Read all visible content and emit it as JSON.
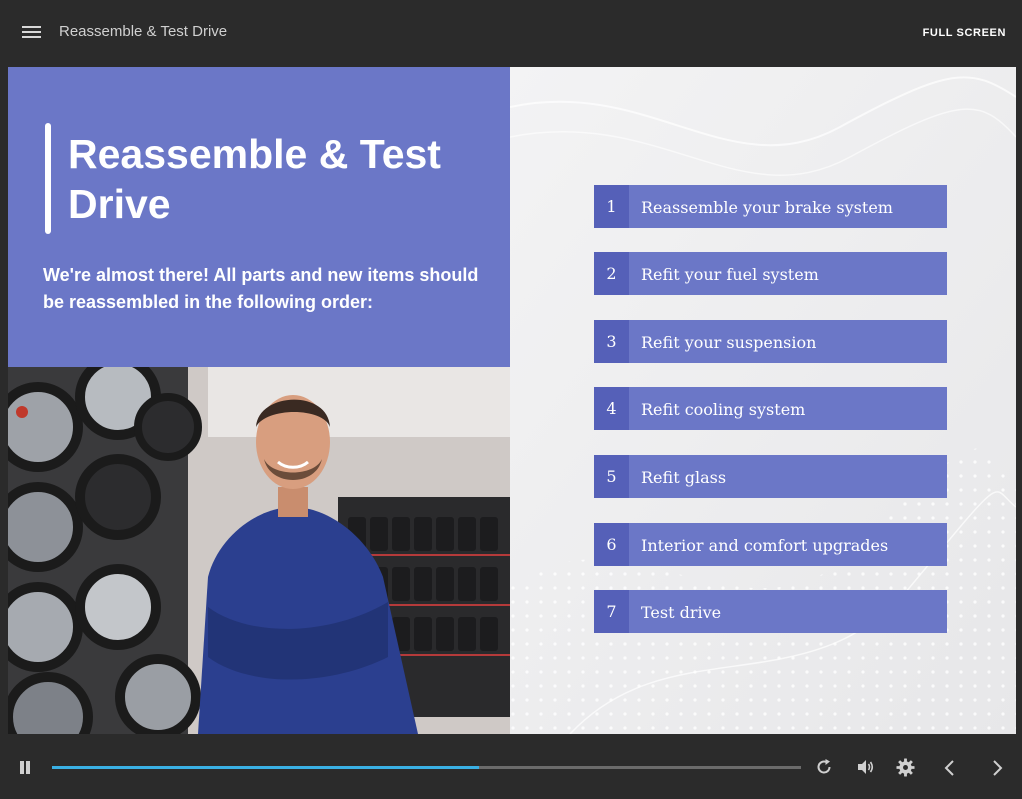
{
  "header": {
    "course_title": "Reassemble & Test Drive",
    "fullscreen_label": "FULL SCREEN"
  },
  "slide": {
    "title": "Reassemble & Test Drive",
    "subtitle": "We're almost there! All parts and new items should be reassembled in the following order:",
    "steps": [
      {
        "number": "1",
        "label": "Reassemble your brake system"
      },
      {
        "number": "2",
        "label": "Refit your fuel system"
      },
      {
        "number": "3",
        "label": "Refit your suspension"
      },
      {
        "number": "4",
        "label": "Refit cooling system"
      },
      {
        "number": "5",
        "label": "Refit glass"
      },
      {
        "number": "6",
        "label": "Interior and comfort upgrades"
      },
      {
        "number": "7",
        "label": "Test drive"
      }
    ]
  },
  "player": {
    "progress_fraction": 0.57,
    "icons": [
      "pause-icon",
      "replay-icon",
      "volume-icon",
      "gear-icon",
      "chevron-left-icon",
      "chevron-right-icon"
    ]
  },
  "colors": {
    "accent": "#6b77c7",
    "accent_dark": "#5560b8",
    "progress": "#3ab0e4",
    "chrome": "#2b2b2b"
  }
}
